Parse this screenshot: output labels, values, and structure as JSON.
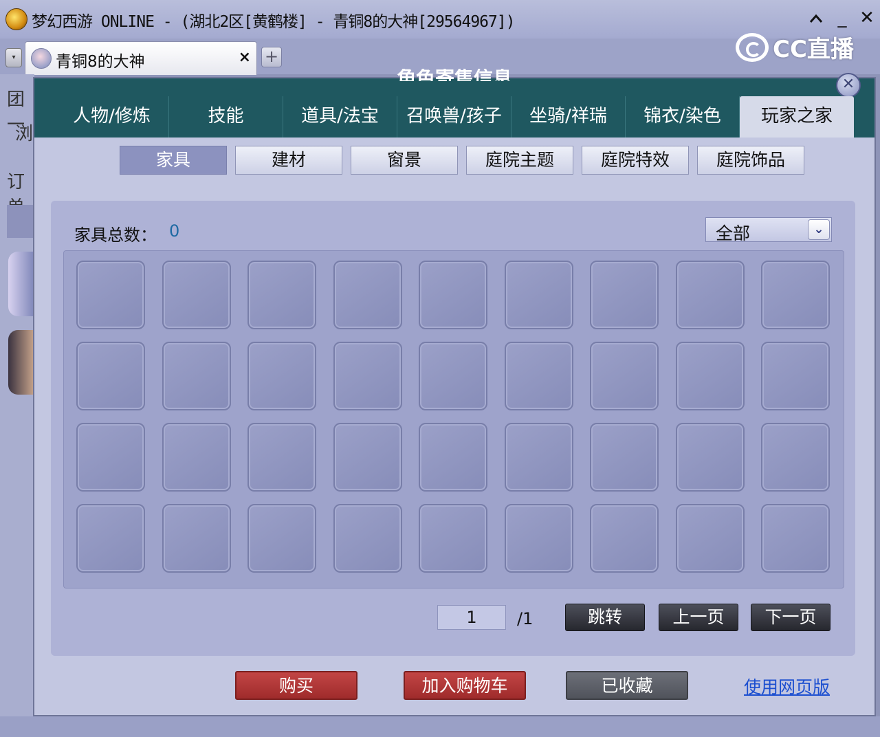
{
  "window": {
    "title": "梦幻西游 ONLINE - (湖北2区[黄鹤楼] - 青铜8的大神[29564967])",
    "collapse_icon": "chevron-up-icon",
    "minimize_symbol": "_",
    "close_symbol": "✕"
  },
  "tabbar": {
    "active_tab_title": "青铜8的大神",
    "close_symbol": "×",
    "add_symbol": "+",
    "dropdown_symbol": "▾"
  },
  "overlay_logo": {
    "text": "CC直播"
  },
  "background": {
    "side_texts": [
      "团一",
      "浏",
      "订单"
    ]
  },
  "dialog": {
    "title": "角色寄售信息",
    "close_symbol": "✕",
    "main_tabs": [
      {
        "label": "人物/修炼",
        "active": false
      },
      {
        "label": "技能",
        "active": false
      },
      {
        "label": "道具/法宝",
        "active": false
      },
      {
        "label": "召唤兽/孩子",
        "active": false
      },
      {
        "label": "坐骑/祥瑞",
        "active": false
      },
      {
        "label": "锦衣/染色",
        "active": false
      },
      {
        "label": "玩家之家",
        "active": true
      }
    ],
    "sub_tabs": [
      {
        "label": "家具",
        "active": true
      },
      {
        "label": "建材",
        "active": false
      },
      {
        "label": "窗景",
        "active": false
      },
      {
        "label": "庭院主题",
        "active": false
      },
      {
        "label": "庭院特效",
        "active": false
      },
      {
        "label": "庭院饰品",
        "active": false
      }
    ],
    "panel": {
      "count_label": "家具总数：",
      "count_value": "0",
      "filter_selected": "全部",
      "slot_rows": 4,
      "slot_cols": 9
    },
    "pagination": {
      "current_page": "1",
      "total_pages": "/1",
      "jump_label": "跳转",
      "prev_label": "上一页",
      "next_label": "下一页"
    },
    "actions": {
      "buy_label": "购买",
      "add_cart_label": "加入购物车",
      "favorited_label": "已收藏",
      "web_version_label": "使用网页版"
    }
  }
}
